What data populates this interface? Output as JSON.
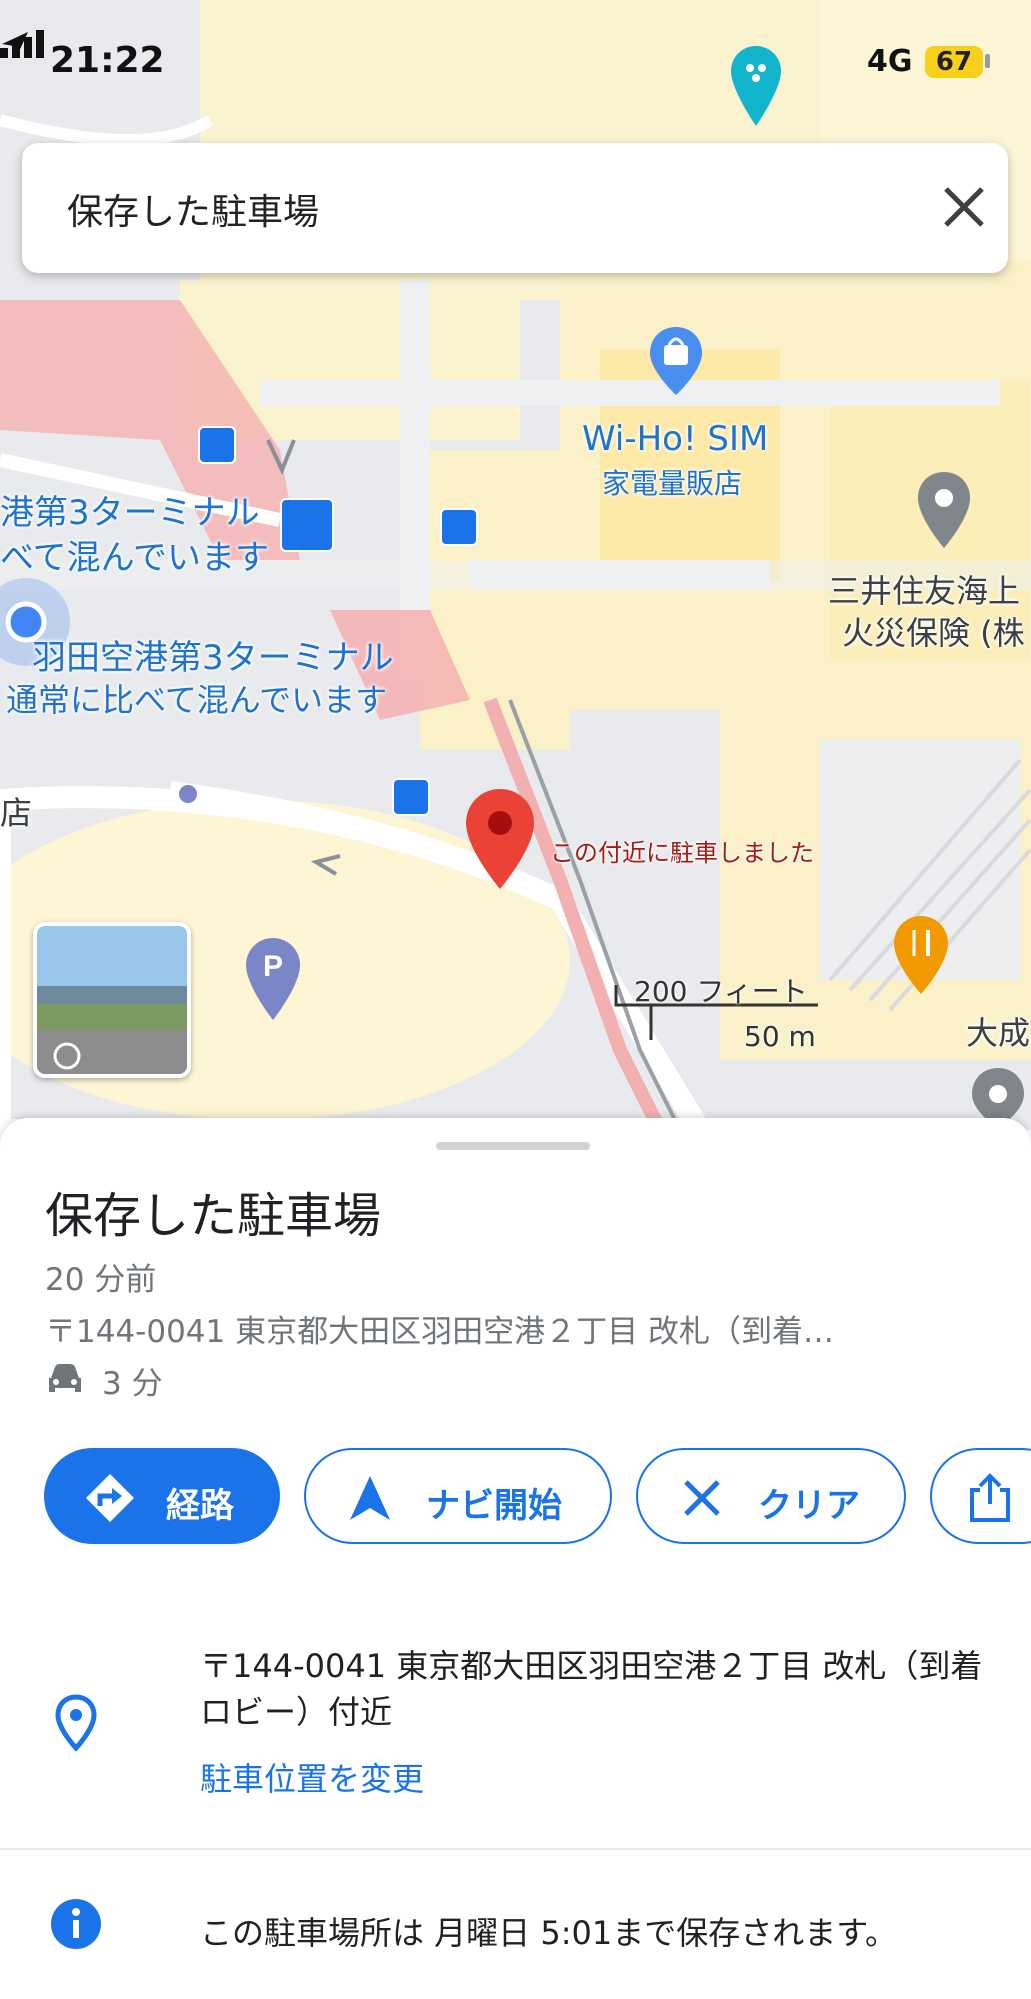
{
  "status_bar": {
    "time": "21:22",
    "network": "4G",
    "battery": "67"
  },
  "search": {
    "query": "保存した駐車場"
  },
  "map": {
    "labels": {
      "shop_name": "Wi-Ho! SIM",
      "shop_type": "家電量販店",
      "terminal_left_1": "港第3ターミナル",
      "terminal_left_2": "べて混んでいます",
      "terminal_name": "羽田空港第3ターミナル",
      "terminal_status": "通常に比べて混んでいます",
      "insurance_1": "三井住友海上",
      "insurance_2": "火災保険 (株",
      "parked_note": "この付近に駐車しました",
      "left_edge": "店",
      "right_edge": "大成",
      "scale_ft": "200 フィート",
      "scale_m": "50 m"
    }
  },
  "sheet": {
    "title": "保存した駐車場",
    "time_ago": "20 分前",
    "address_short": "〒144-0041 東京都大田区羽田空港２丁目 改札（到着…",
    "drive_time": "3 分",
    "buttons": {
      "route": "経路",
      "navigate": "ナビ開始",
      "clear": "クリア"
    },
    "address_full": "〒144-0041 東京都大田区羽田空港２丁目 改札（到着ロビー）付近",
    "change_location": "駐車位置を変更",
    "info": "この駐車場所は 月曜日 5:01まで保存されます。"
  },
  "colors": {
    "accent": "#1a73e8",
    "pin": "#ea4335",
    "parking": "#5c6bc0",
    "food": "#f29900"
  }
}
